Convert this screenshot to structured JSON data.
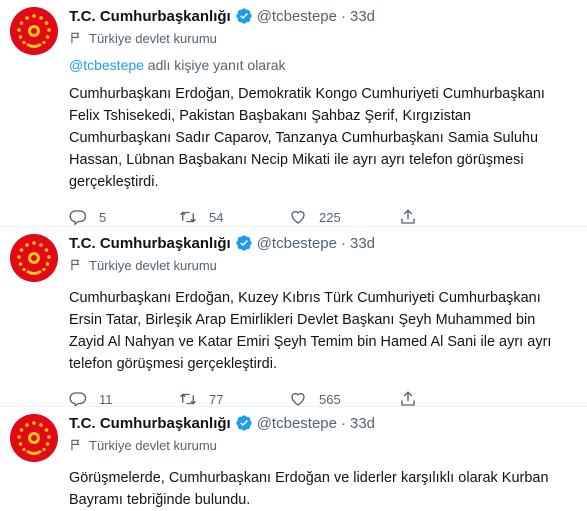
{
  "tweets": [
    {
      "name": "T.C. Cumhurbaşkanlığı",
      "handle": "@tcbestepe",
      "separator": "·",
      "time": "33d",
      "label": "Türkiye devlet kurumu",
      "reply_mention": "@tcbestepe",
      "reply_suffix": " adlı kişiye yanıt olarak",
      "text": "Cumhurbaşkanı Erdoğan, Demokratik Kongo Cumhuriyeti Cumhurbaşkanı Felix Tshisekedi, Pakistan Başbakanı Şahbaz Şerif, Kırgızistan Cumhurbaşkanı Sadır Caparov, Tanzanya Cumhurbaşkanı Samia Suluhu Hassan, Lübnan Başbakanı Necip Mikati ile ayrı ayrı telefon görüşmesi gerçekleştirdi.",
      "replies": "5",
      "retweets": "54",
      "likes": "225"
    },
    {
      "name": "T.C. Cumhurbaşkanlığı",
      "handle": "@tcbestepe",
      "separator": "·",
      "time": "33d",
      "label": "Türkiye devlet kurumu",
      "text": "Cumhurbaşkanı Erdoğan, Kuzey Kıbrıs Türk Cumhuriyeti Cumhurbaşkanı Ersin Tatar, Birleşik Arap Emirlikleri Devlet Başkanı Şeyh Muhammed bin Zayid Al Nahyan ve Katar Emiri Şeyh Temim bin Hamed Al Sani ile ayrı ayrı telefon görüşmesi gerçekleştirdi.",
      "replies": "11",
      "retweets": "77",
      "likes": "565"
    },
    {
      "name": "T.C. Cumhurbaşkanlığı",
      "handle": "@tcbestepe",
      "separator": "·",
      "time": "33d",
      "label": "Türkiye devlet kurumu",
      "text": "Görüşmelerde, Cumhurbaşkanı Erdoğan ve liderler karşılıklı olarak Kurban Bayramı tebriğinde bulundu."
    }
  ],
  "colors": {
    "accent": "#1d9bf0",
    "secondary_text": "#536471",
    "avatar_red": "#e30a17",
    "seal_gold": "#f5c518"
  },
  "icons": [
    "presidential-seal-avatar",
    "verified-badge-icon",
    "flag-icon",
    "reply-icon",
    "retweet-icon",
    "like-icon",
    "share-icon"
  ]
}
